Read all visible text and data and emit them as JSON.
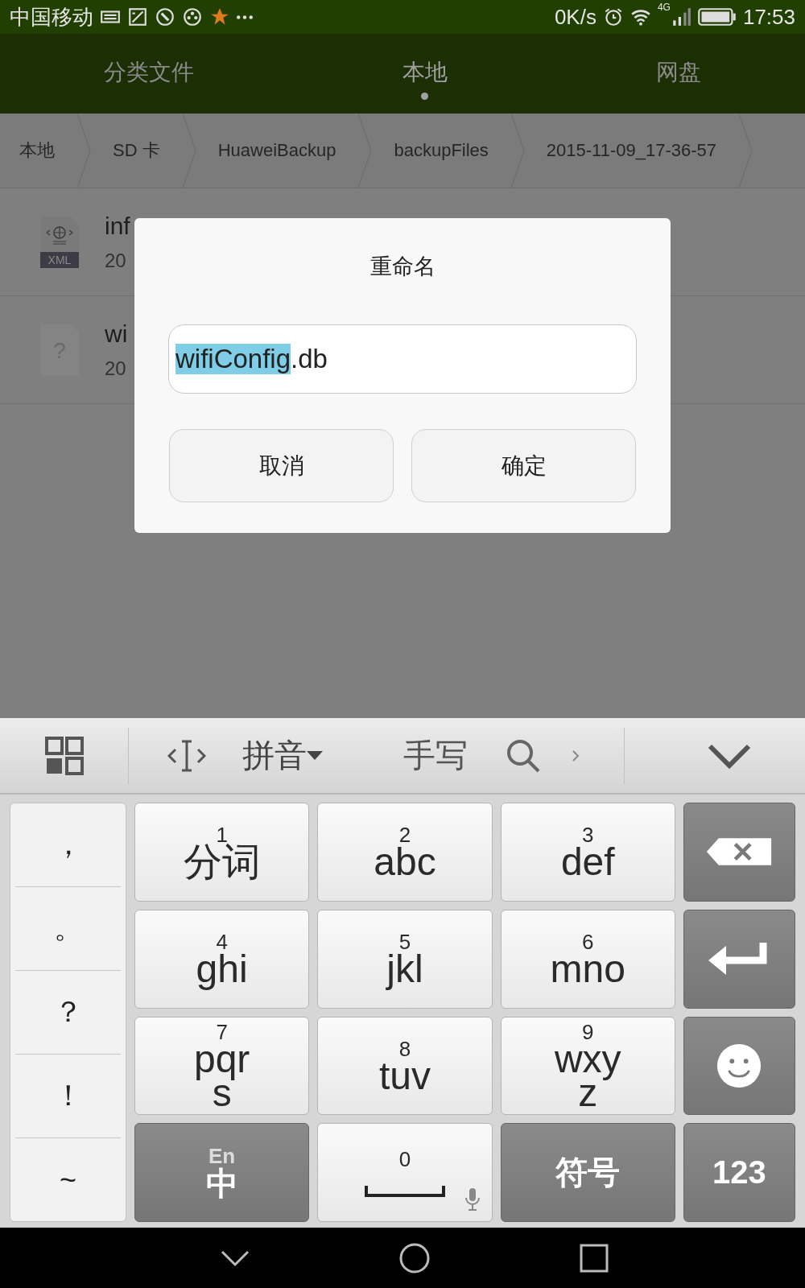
{
  "status_bar": {
    "carrier": "中国移动",
    "speed": "0K/s",
    "network": "4G",
    "time": "17:53"
  },
  "tabs": [
    {
      "label": "分类文件",
      "selected": false
    },
    {
      "label": "本地",
      "selected": true
    },
    {
      "label": "网盘",
      "selected": false
    }
  ],
  "breadcrumb": [
    "本地",
    "SD 卡",
    "HuaweiBackup",
    "backupFiles",
    "2015-11-09_17-36-57"
  ],
  "files": [
    {
      "kind": "xml",
      "icon_label": "XML",
      "name": "inf",
      "date": "20"
    },
    {
      "kind": "unknown",
      "icon_label": "?",
      "name": "wi",
      "date": "20"
    }
  ],
  "dialog": {
    "title": "重命名",
    "field": {
      "selected_text": "wifiConfig",
      "rest": ".db"
    },
    "buttons": [
      "取消",
      "确定"
    ]
  },
  "keyboard": {
    "toolbar": {
      "modes": [
        {
          "label": "拼音",
          "dropdown": true
        },
        {
          "label": "手写",
          "dropdown": false
        }
      ]
    },
    "symbols": [
      "，",
      "。",
      "？",
      "！",
      "~"
    ],
    "keys": [
      {
        "kind": "t9",
        "digit": "1",
        "letters": "分词"
      },
      {
        "kind": "t9",
        "digit": "2",
        "letters": "abc"
      },
      {
        "kind": "t9",
        "digit": "3",
        "letters": "def"
      },
      {
        "kind": "backspace"
      },
      {
        "kind": "t9",
        "digit": "4",
        "letters": "ghi"
      },
      {
        "kind": "t9",
        "digit": "5",
        "letters": "jkl"
      },
      {
        "kind": "t9",
        "digit": "6",
        "letters": "mno"
      },
      {
        "kind": "enter"
      },
      {
        "kind": "t9",
        "digit": "7",
        "letters": "pqr\ns"
      },
      {
        "kind": "t9",
        "digit": "8",
        "letters": "tuv"
      },
      {
        "kind": "t9",
        "digit": "9",
        "letters": "wxy\nz"
      },
      {
        "kind": "emoji"
      },
      {
        "kind": "lang",
        "digit": "En",
        "letters": "中"
      },
      {
        "kind": "space",
        "digit": "0"
      },
      {
        "kind": "label",
        "letters": "符号"
      },
      {
        "kind": "label",
        "letters": "123"
      }
    ]
  }
}
